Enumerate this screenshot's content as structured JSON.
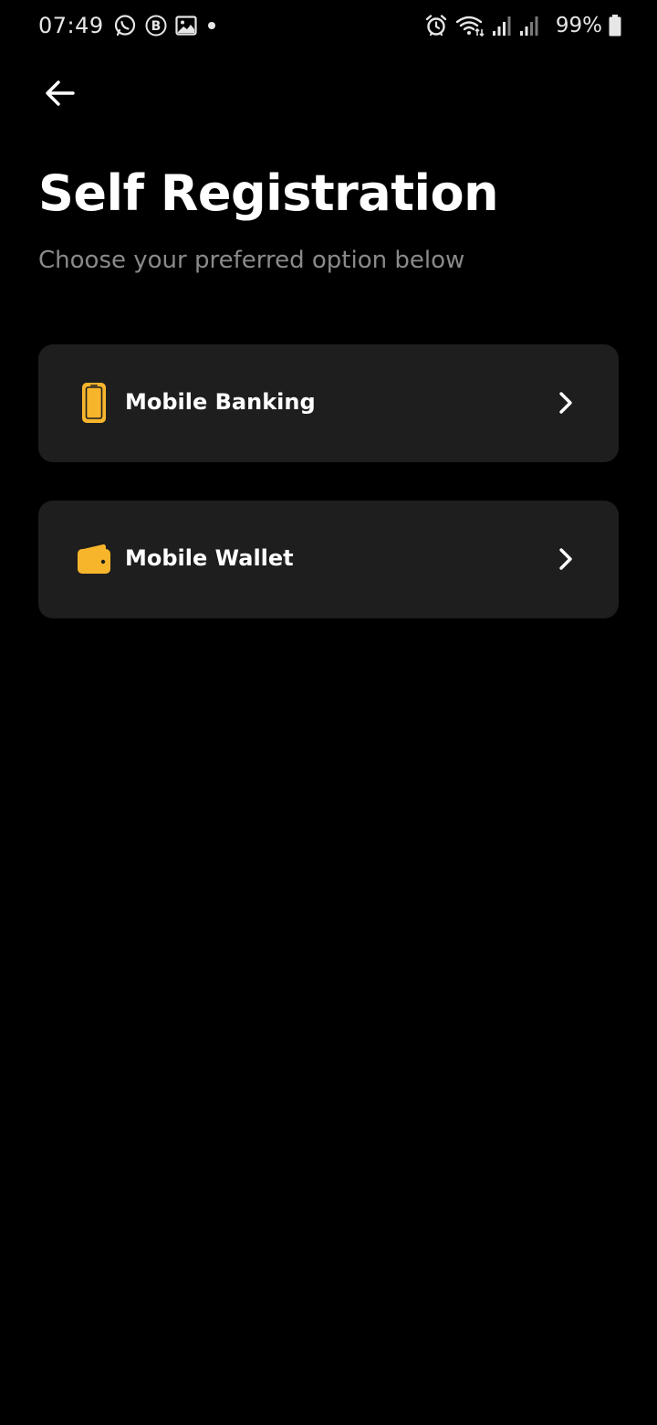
{
  "status_bar": {
    "time": "07:49",
    "battery_percent": "99%",
    "icons": [
      "whatsapp-icon",
      "b-circle-icon",
      "gallery-icon",
      "dot-icon",
      "alarm-icon",
      "wifi-icon",
      "signal-icon",
      "signal-icon",
      "battery-icon"
    ]
  },
  "header": {
    "back_icon": "arrow-left-icon",
    "title": "Self Registration",
    "subtitle": "Choose your preferred option below"
  },
  "options": [
    {
      "label": "Mobile Banking",
      "icon": "phone-icon"
    },
    {
      "label": "Mobile Wallet",
      "icon": "wallet-icon"
    }
  ],
  "colors": {
    "background": "#000000",
    "card": "#1e1e1e",
    "accent": "#f7b52c",
    "subtitle": "#8a8a8a"
  }
}
